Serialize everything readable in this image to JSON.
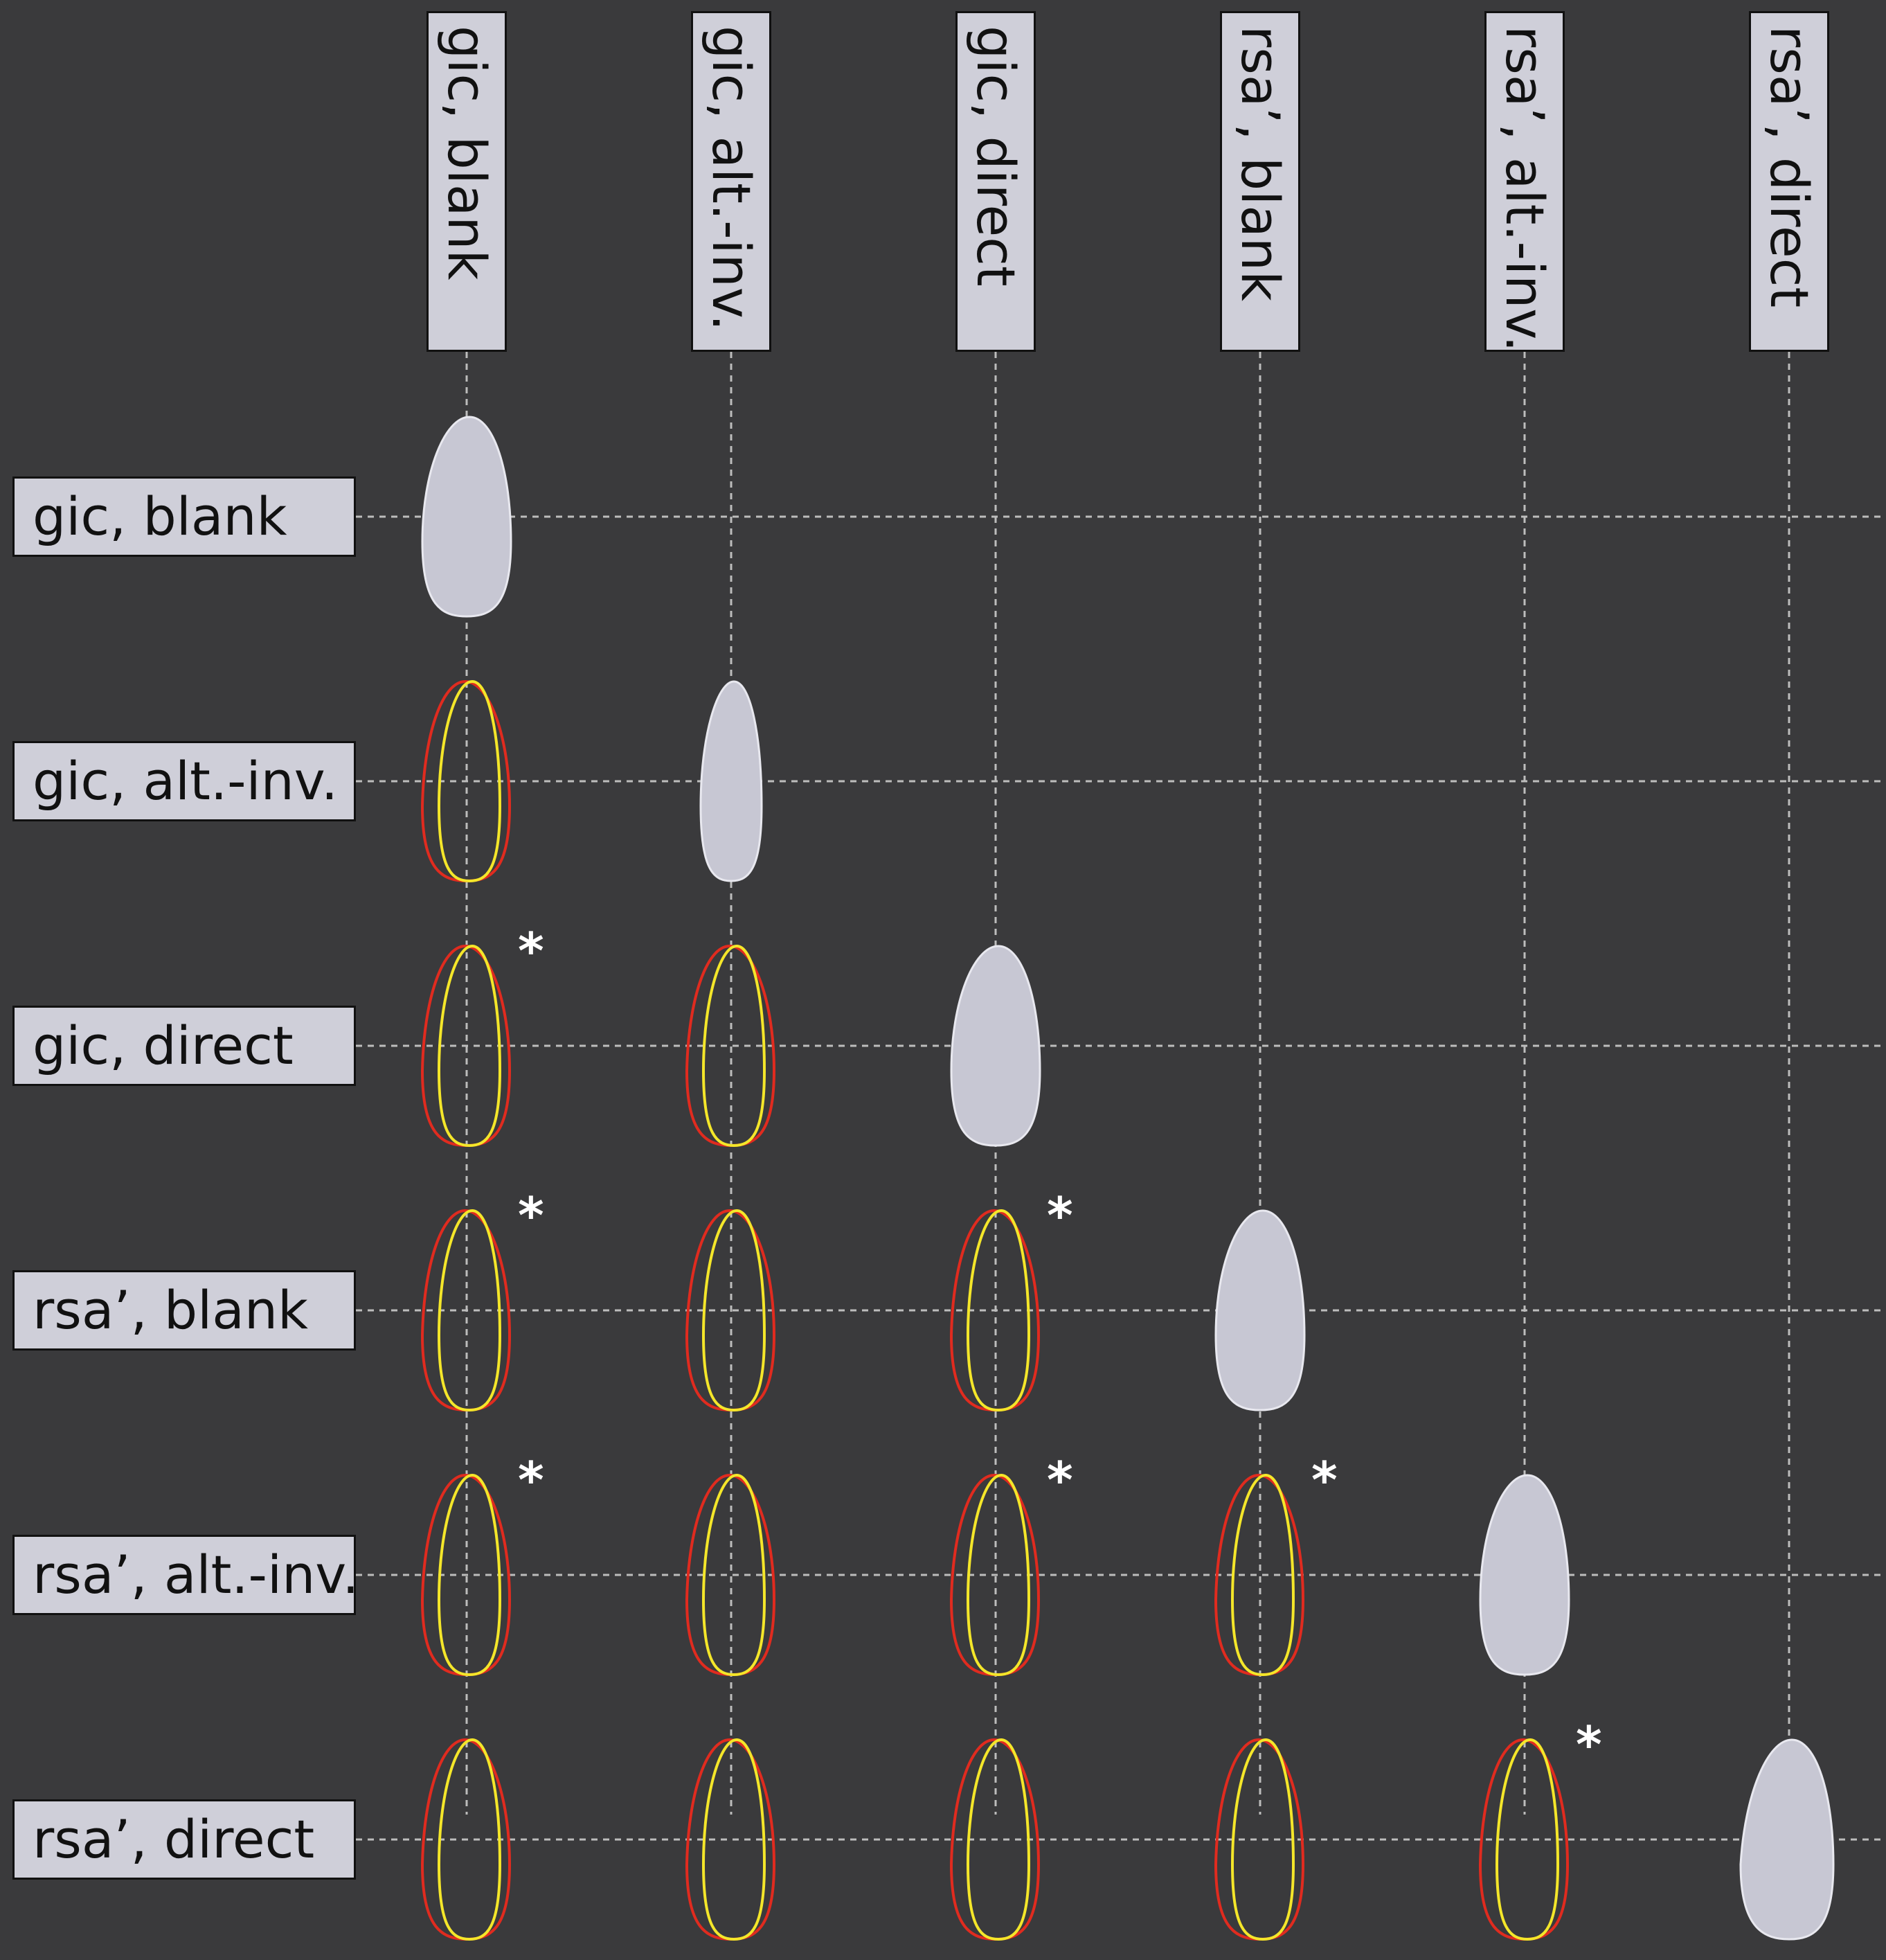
{
  "columns": [
    {
      "label": "gic, blank"
    },
    {
      "label": "gic, alt.-inv."
    },
    {
      "label": "gic, direct"
    },
    {
      "label": "rsa’, blank"
    },
    {
      "label": "rsa’, alt.-inv."
    },
    {
      "label": "rsa’, direct"
    }
  ],
  "rows": [
    {
      "label": "gic, blank"
    },
    {
      "label": "gic, alt.-inv."
    },
    {
      "label": "gic, direct"
    },
    {
      "label": "rsa’, blank"
    },
    {
      "label": "rsa’, alt.-inv."
    },
    {
      "label": "rsa’, direct"
    }
  ],
  "diagonal_marker_shape": "filled-egg",
  "comparison_outlines": [
    "red",
    "yellow"
  ],
  "significance_mark": "*",
  "significant_cells": [
    [
      2,
      0
    ],
    [
      3,
      0
    ],
    [
      3,
      2
    ],
    [
      4,
      0
    ],
    [
      4,
      2
    ],
    [
      4,
      3
    ],
    [
      5,
      4
    ]
  ],
  "colors": {
    "background": "#3a3a3c",
    "label_fill": "#cfcfd9",
    "diagonal_fill": "#c7c7d3",
    "outline_red": "#e02b1f",
    "outline_yellow": "#f4e62a",
    "grid_line": "#bdbdbd",
    "asterisk": "#ffffff"
  }
}
